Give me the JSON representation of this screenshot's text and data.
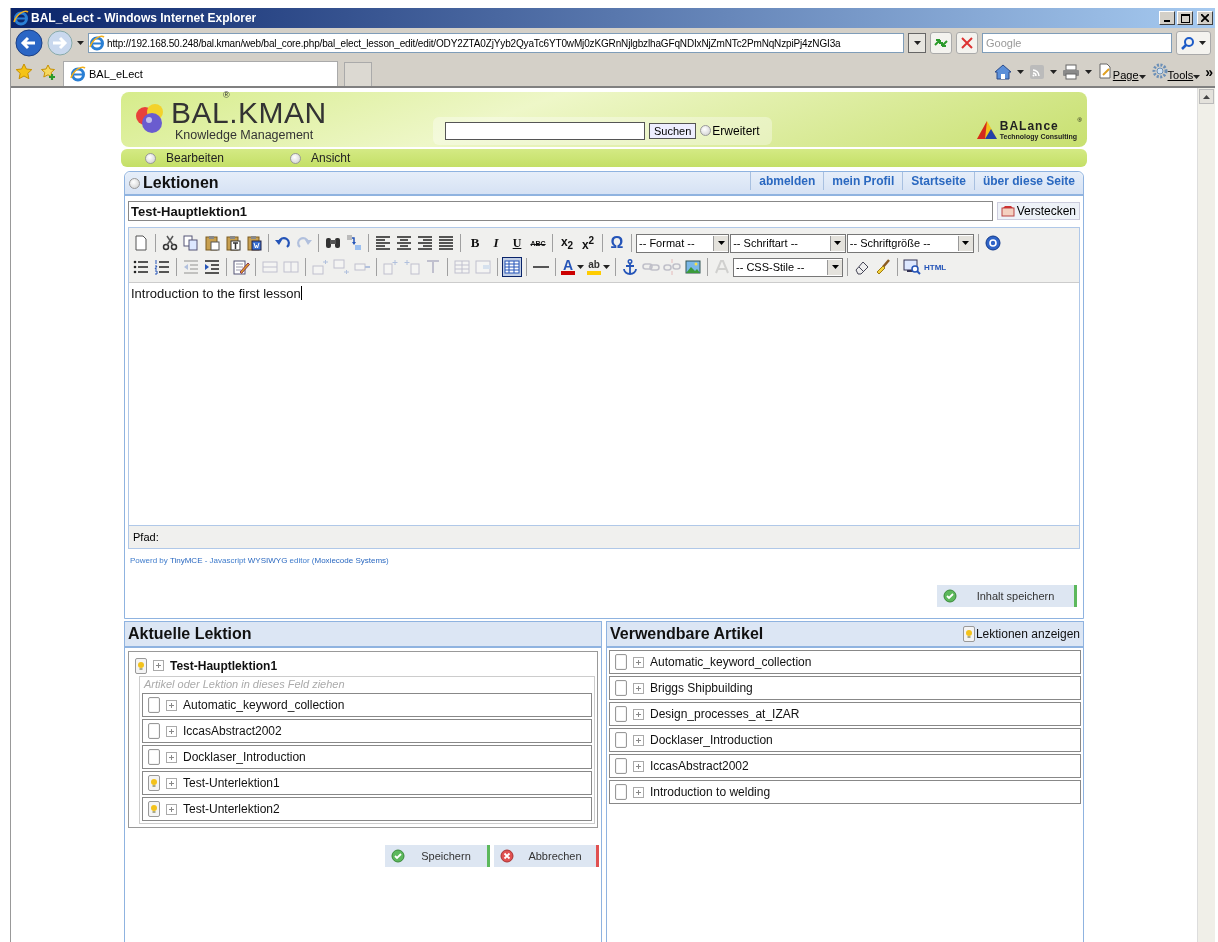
{
  "browser": {
    "title": "BAL_eLect - Windows Internet Explorer",
    "address": "http://192.168.50.248/bal.kman/web/bal_core.php/bal_elect_lesson_edit/edit/ODY2ZTA0ZjYyb2QyaTc6YT0wMj0zKGRnNjlgbzlhaGFqNDIxNjZmNTc2PmNqNzpiPj4zNGI3a",
    "search_placeholder": "Google",
    "tabs": [
      {
        "label": "BAL_eLect",
        "selected": true
      }
    ],
    "command_bar": [
      "Page",
      "Tools"
    ],
    "overflow": "»"
  },
  "header": {
    "logo": "BAL.KMAN",
    "logo_mark": "®",
    "tagline": "Knowledge Management",
    "search_button": "Suchen",
    "advanced": {
      "label": "Erweitert",
      "selected": false
    },
    "partner_logo": "BALance",
    "partner_mark": "®",
    "partner_tagline": "Technology Consulting"
  },
  "menu": [
    {
      "label": "Bearbeiten",
      "selected": false
    },
    {
      "label": "Ansicht",
      "selected": false
    }
  ],
  "panel": {
    "title": "Lektionen",
    "links": [
      "abmelden",
      "mein Profil",
      "Startseite",
      "über diese Seite"
    ]
  },
  "lesson_title": "Test-Hauptlektion1",
  "hide_button": "Verstecken",
  "editor": {
    "toolbars": [
      {
        "items": [
          {
            "kind": "button",
            "disabled": false,
            "active": false
          },
          {
            "kind": "sep"
          },
          {
            "kind": "button",
            "disabled": false,
            "active": false
          },
          {
            "kind": "button",
            "disabled": false,
            "active": false
          },
          {
            "kind": "button",
            "disabled": false,
            "active": false
          },
          {
            "kind": "button",
            "disabled": false,
            "active": false
          },
          {
            "kind": "button",
            "disabled": false,
            "active": false
          },
          {
            "kind": "sep"
          },
          {
            "kind": "button",
            "disabled": false,
            "active": false
          },
          {
            "kind": "button",
            "disabled": true,
            "active": false
          },
          {
            "kind": "sep"
          },
          {
            "kind": "button",
            "disabled": false,
            "active": false
          },
          {
            "kind": "button",
            "disabled": false,
            "active": false
          },
          {
            "kind": "sep"
          },
          {
            "kind": "button",
            "disabled": false,
            "active": false
          },
          {
            "kind": "button",
            "disabled": false,
            "active": false
          },
          {
            "kind": "button",
            "disabled": false,
            "active": false
          },
          {
            "kind": "button",
            "disabled": false,
            "active": false
          },
          {
            "kind": "sep"
          },
          {
            "kind": "glyph",
            "text": "B",
            "disabled": false,
            "active": false
          },
          {
            "kind": "glyph",
            "text": "I",
            "disabled": false,
            "active": false
          },
          {
            "kind": "glyph",
            "text": "U",
            "disabled": false,
            "active": false
          },
          {
            "kind": "glyph",
            "text": "ABC",
            "disabled": false,
            "active": false
          },
          {
            "kind": "sep"
          },
          {
            "kind": "glyph",
            "text": "x$_{2}$",
            "disabled": false,
            "active": false
          },
          {
            "kind": "glyph",
            "text": "x$^{2}$",
            "disabled": false,
            "active": false
          },
          {
            "kind": "sep"
          },
          {
            "kind": "glyph",
            "text": "Ω",
            "disabled": false,
            "active": false
          },
          {
            "kind": "sep"
          },
          {
            "kind": "select",
            "label": "-- Format --"
          },
          {
            "kind": "select",
            "label": "-- Schriftart --"
          },
          {
            "kind": "select",
            "label": "-- Schriftgröße --"
          },
          {
            "kind": "sep"
          },
          {
            "kind": "button",
            "disabled": false,
            "active": false
          }
        ]
      },
      {
        "items": [
          {
            "kind": "button",
            "disabled": false,
            "active": false
          },
          {
            "kind": "button",
            "disabled": false,
            "active": false
          },
          {
            "kind": "sep"
          },
          {
            "kind": "button",
            "disabled": true,
            "active": false
          },
          {
            "kind": "button",
            "disabled": false,
            "active": false
          },
          {
            "kind": "sep"
          },
          {
            "kind": "button",
            "disabled": false,
            "active": false
          },
          {
            "kind": "sep"
          },
          {
            "kind": "button",
            "disabled": true,
            "active": false
          },
          {
            "kind": "button",
            "disabled": true,
            "active": false
          },
          {
            "kind": "sep"
          },
          {
            "kind": "button",
            "disabled": true,
            "active": false
          },
          {
            "kind": "button",
            "disabled": true,
            "active": false
          },
          {
            "kind": "button",
            "disabled": true,
            "active": false
          },
          {
            "kind": "sep"
          },
          {
            "kind": "button",
            "disabled": true,
            "active": false
          },
          {
            "kind": "button",
            "disabled": true,
            "active": false
          },
          {
            "kind": "button",
            "disabled": true,
            "active": false
          },
          {
            "kind": "sep"
          },
          {
            "kind": "button",
            "disabled": true,
            "active": false
          },
          {
            "kind": "button",
            "disabled": true,
            "active": false
          },
          {
            "kind": "sep"
          },
          {
            "kind": "button",
            "disabled": false,
            "active": true
          },
          {
            "kind": "sep"
          },
          {
            "kind": "button",
            "disabled": false,
            "active": false
          },
          {
            "kind": "sep"
          },
          {
            "kind": "glyph",
            "text": "A",
            "disabled": false,
            "active": false,
            "color": "#cc0000"
          },
          {
            "kind": "glyph",
            "text": "ab",
            "disabled": false,
            "active": false,
            "color": "#ffcc00"
          },
          {
            "kind": "sep"
          },
          {
            "kind": "button",
            "disabled": false,
            "active": false
          },
          {
            "kind": "button",
            "disabled": true,
            "active": false
          },
          {
            "kind": "button",
            "disabled": true,
            "active": false
          },
          {
            "kind": "button",
            "disabled": false,
            "active": false
          },
          {
            "kind": "sep"
          },
          {
            "kind": "button",
            "disabled": true,
            "active": false
          },
          {
            "kind": "select",
            "label": "-- CSS-Stile --"
          },
          {
            "kind": "sep"
          },
          {
            "kind": "button",
            "disabled": false,
            "active": false
          },
          {
            "kind": "button",
            "disabled": false,
            "active": false
          },
          {
            "kind": "sep"
          },
          {
            "kind": "button",
            "disabled": false,
            "active": false
          },
          {
            "kind": "glyph",
            "text": "HTML",
            "disabled": false,
            "active": false
          }
        ]
      }
    ],
    "content": "Introduction to the first lesson",
    "path_label": "Pfad:",
    "credit": [
      {
        "text": "Powerd by ",
        "kind": "text"
      },
      {
        "text": "TinyMCE",
        "kind": "link"
      },
      {
        "text": " - Javascript ",
        "kind": "text"
      },
      {
        "text": "WYSIWYG",
        "kind": "link"
      },
      {
        "text": " editor (",
        "kind": "text"
      },
      {
        "text": "Moxiecode Systems",
        "kind": "link"
      },
      {
        "text": ")",
        "kind": "text"
      }
    ],
    "save_button": "Inhalt speichern"
  },
  "current_lesson": {
    "title": "Aktuelle Lektion",
    "tree": {
      "label": "Test-Hauptlektion1",
      "kind": "lesson",
      "placeholder": "Artikel oder Lektion in dieses Feld ziehen",
      "children": [
        {
          "label": "Automatic_keyword_collection",
          "kind": "article"
        },
        {
          "label": "IccasAbstract2002",
          "kind": "article"
        },
        {
          "label": "Docklaser_Introduction",
          "kind": "article"
        },
        {
          "label": "Test-Unterlektion1",
          "kind": "lesson"
        },
        {
          "label": "Test-Unterlektion2",
          "kind": "lesson"
        }
      ]
    },
    "buttons": [
      {
        "label": "Speichern",
        "kind": "ok"
      },
      {
        "label": "Abbrechen",
        "kind": "cancel"
      }
    ]
  },
  "available_articles": {
    "title": "Verwendbare Artikel",
    "toggle_button": "Lektionen anzeigen",
    "items": [
      {
        "label": "Automatic_keyword_collection",
        "kind": "article"
      },
      {
        "label": "Briggs Shipbuilding",
        "kind": "article"
      },
      {
        "label": "Design_processes_at_IZAR",
        "kind": "article"
      },
      {
        "label": "Docklaser_Introduction",
        "kind": "article"
      },
      {
        "label": "IccasAbstract2002",
        "kind": "article"
      },
      {
        "label": "Introduction to welding",
        "kind": "article"
      }
    ]
  }
}
